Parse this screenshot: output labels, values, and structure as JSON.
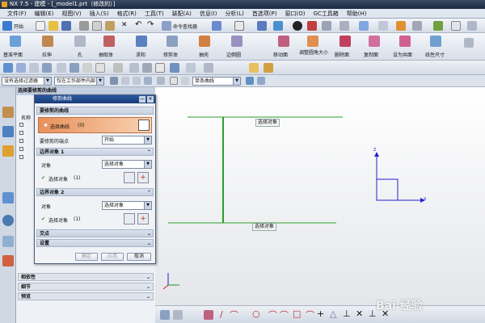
{
  "app": {
    "title": "NX 7.5 - 建模 - [_model1.prt（修改的）]"
  },
  "menu": [
    "文件(F)",
    "编辑(E)",
    "视图(V)",
    "插入(S)",
    "格式(R)",
    "工具(T)",
    "装配(A)",
    "信息(I)",
    "分析(L)",
    "首选项(P)",
    "窗口(O)",
    "GC工具箱",
    "帮助(H)"
  ],
  "toolbar1": {
    "start_label": "开始",
    "command_finder": "命令查找器"
  },
  "toolbar2": {
    "items": [
      "基准平面",
      "拉伸",
      "孔",
      "抽取体",
      "求和",
      "修剪体",
      "抽壳",
      "边倒圆",
      "移动面",
      "调整圆角大小",
      "删除面",
      "复制面",
      "设为共面",
      "线性尺寸"
    ]
  },
  "filterbar": {
    "filter": "没有选择过滤器",
    "scope": "仅在工作部件内部",
    "snap": "单条曲线"
  },
  "nav": {
    "title": "选择要修剪的曲线",
    "name_col": "名称",
    "sections": [
      "相依性",
      "细节",
      "预览"
    ]
  },
  "dialog": {
    "title": "修剪曲线",
    "sec_curve": "要修剪的曲线",
    "select_curve": "选择曲线",
    "select_curve_count": "(0)",
    "end_label": "要修剪的端点",
    "end_value": "开始",
    "boundary1": "边界对象 1",
    "boundary2": "边界对象 2",
    "object_label": "对象",
    "object_value": "选择对象",
    "select_object": "选择对象",
    "select_object_count": "(1)",
    "intersection": "交点",
    "settings": "设置",
    "ok": "确定",
    "apply": "应用",
    "cancel": "取消"
  },
  "canvas": {
    "tag_top": "选择对象",
    "tag_bottom": "选择对象",
    "axis_x": "X",
    "axis_y": "Y",
    "axis_z": "Z"
  },
  "watermark": "Bai 经验",
  "colors": {
    "title_bg": "#1d2a40",
    "dialog_title": "#1a3a78",
    "curve_green": "#2aa02a",
    "csys_blue": "#2222cc",
    "highlight": "#f4c49c"
  }
}
